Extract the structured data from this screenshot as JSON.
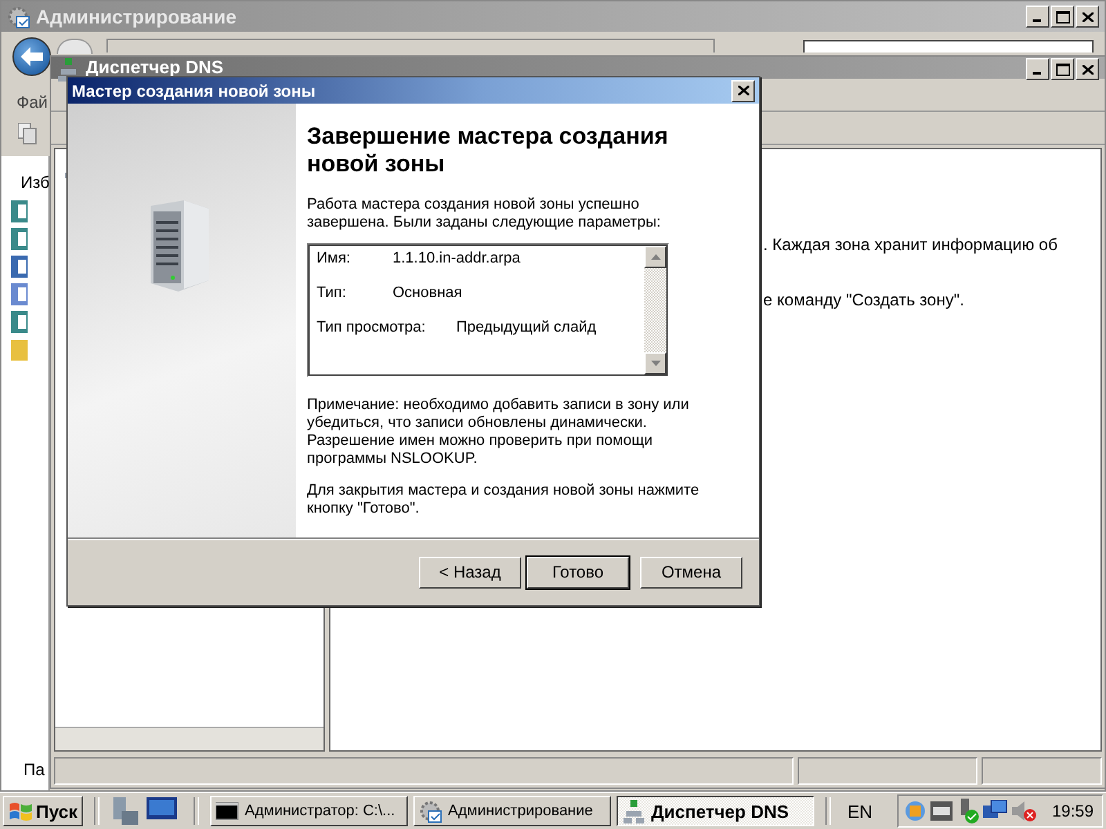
{
  "admin_window": {
    "title": "Администрирование",
    "menu_partial": "Фай",
    "pane_title_partial": "Изб",
    "status_partial": "Па"
  },
  "dns_window": {
    "title": "Диспетчер DNS",
    "content_lines": [
      ". Каждая зона хранит информацию об",
      "е команду \"Создать зону\"."
    ]
  },
  "wizard": {
    "title": "Мастер создания новой зоны",
    "heading": "Завершение мастера создания новой зоны",
    "intro": "Работа мастера создания новой зоны успешно завершена. Были заданы следующие параметры:",
    "summary": [
      {
        "label": "Имя:",
        "value": "1.1.10.in-addr.arpa"
      },
      {
        "label": "Тип:",
        "value": "Основная"
      },
      {
        "label": "Тип просмотра:",
        "value": "Предыдущий слайд"
      }
    ],
    "note": "Примечание: необходимо добавить записи в зону или убедиться, что записи обновлены динамически. Разрешение имен можно проверить при помощи программы NSLOOKUP.",
    "closing": "Для закрытия мастера и создания новой зоны нажмите кнопку \"Готово\".",
    "buttons": [
      {
        "label": "< Назад",
        "default": false
      },
      {
        "label": "Готово",
        "default": true
      },
      {
        "label": "Отмена",
        "default": false
      }
    ]
  },
  "taskbar": {
    "start": "Пуск",
    "tasks": [
      {
        "label": "Администратор: C:\\...",
        "kind": "console",
        "selected": false
      },
      {
        "label": "Администрирование",
        "kind": "admin",
        "selected": false
      },
      {
        "label": "Диспетчер DNS",
        "kind": "dns",
        "selected": true
      }
    ],
    "language": "EN",
    "clock": "19:59"
  }
}
